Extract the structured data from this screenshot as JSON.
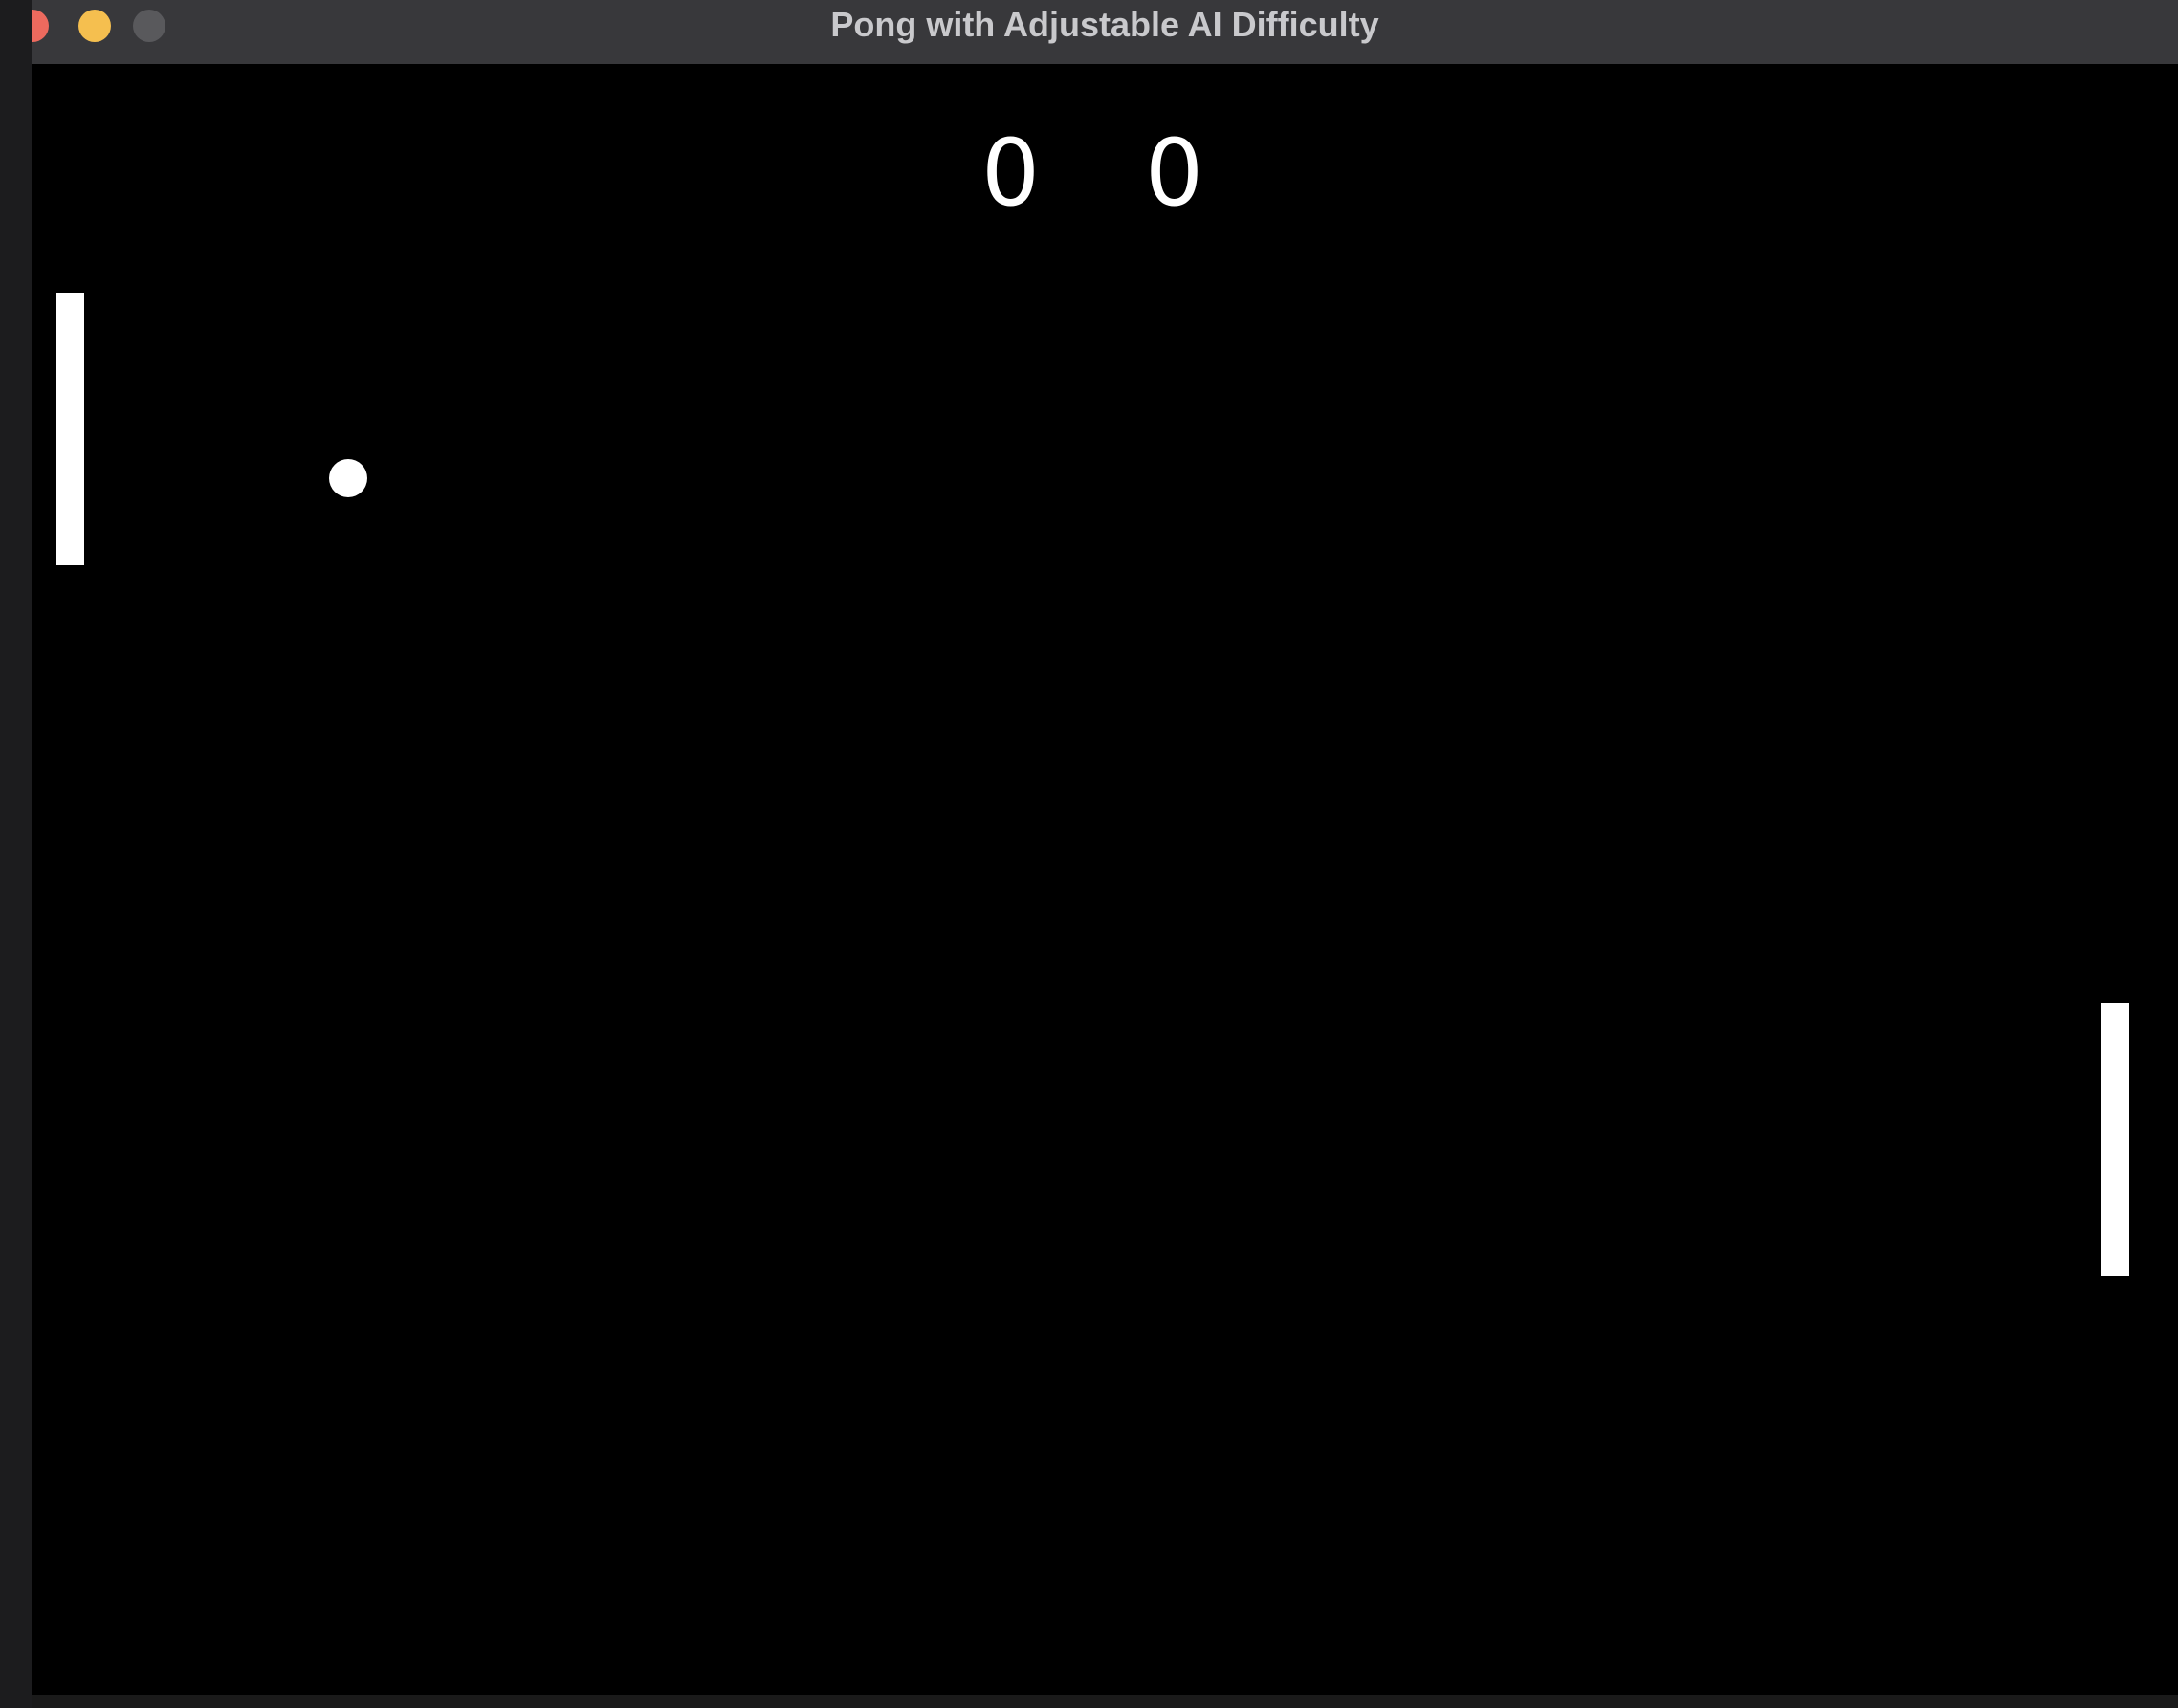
{
  "window": {
    "title": "Pong with Adjustable AI Difficulty"
  },
  "scoreboard": {
    "left_score": "0",
    "right_score": "0"
  },
  "colors": {
    "background": "#000000",
    "foreground": "#ffffff",
    "titlebar": "#38383b",
    "close_button": "#ed6a5e",
    "minimize_button": "#f5bf4f",
    "zoom_button": "#59595c"
  },
  "icons": {
    "close": "close-icon",
    "minimize": "minimize-icon",
    "zoom": "zoom-icon"
  }
}
